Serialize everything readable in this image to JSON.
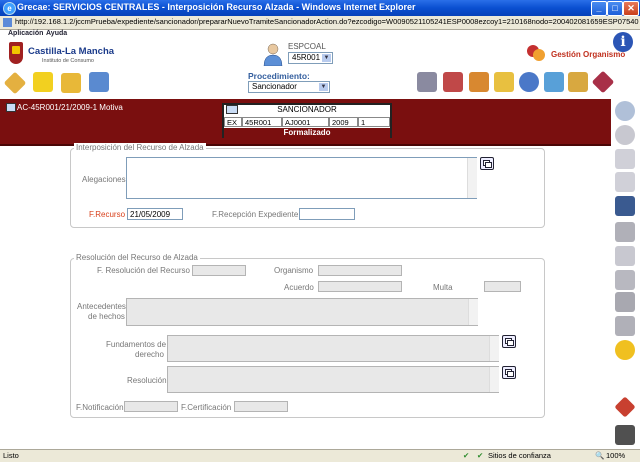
{
  "window": {
    "title": "Grecae: SERVICIOS CENTRALES - Interposición Recurso Alzada - Windows Internet Explorer",
    "minimize": "_",
    "maximize": "□",
    "close": "✕"
  },
  "address": {
    "url": "http://192.168.1.2/jccmPrueba/expediente/sancionador/prepararNuevoTramiteSancionadorAction.do?ezcodigo=W0090521105241ESP0008ezcoy1=210168nodo=200402081659ESP07540"
  },
  "menu": {
    "items": [
      "Aplicación",
      "Ayuda"
    ]
  },
  "header": {
    "logo_name": "Castilla-La Mancha",
    "logo_subtitle": "Instituto de Consumo",
    "user_label": "ESPCOAL",
    "user_select": "45R001",
    "org_label": "Gestión Organismo",
    "info": "i",
    "procedure_label": "Procedimiento:",
    "procedure_select": "Sancionador"
  },
  "band": {
    "title": "AC-45R001/21/2009-1 Motiva",
    "sanc_title": "SANCIONADOR",
    "cells": [
      "EX",
      "45R001",
      "AJ0001",
      "2009",
      "1"
    ],
    "status": "Formalizado"
  },
  "interposicion": {
    "legend": "Interposición del Recurso de Alzada",
    "alegaciones_label": "Alegaciones",
    "alegaciones_value": "",
    "frecurso_label": "F.Recurso",
    "frecurso_value": "21/05/2009",
    "frecepcion_label": "F.Recepción Expediente",
    "frecepcion_value": ""
  },
  "resolucion": {
    "legend": "Resolución del Recurso de Alzada",
    "fresolucion_label": "F. Resolución del Recurso",
    "organismo_label": "Organismo",
    "acuerdo_label": "Acuerdo",
    "multa_label": "Multa",
    "antecedentes_label_1": "Antecedentes",
    "antecedentes_label_2": "de hechos",
    "fundamentos_label_1": "Fundamentos de",
    "fundamentos_label_2": "derecho",
    "resolucion_label": "Resolución",
    "fnotificacion_label": "F.Notificación",
    "fcertificacion_label": "F.Certificación"
  },
  "status": {
    "left": "Listo",
    "zone": "Sitios de confianza",
    "zoom": "100%"
  },
  "colors": {
    "band": "#7a0f0f",
    "accent": "#335e9e",
    "required": "#d8401c"
  }
}
